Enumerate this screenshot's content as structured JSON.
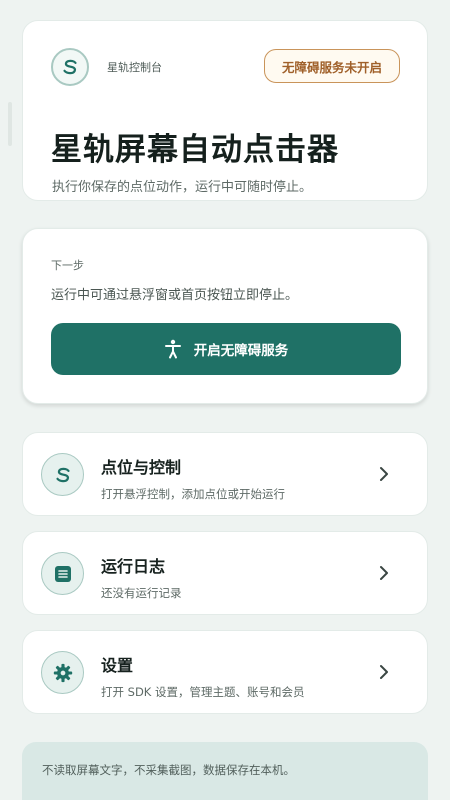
{
  "header": {
    "brand_name": "星轨控制台",
    "status_badge": "无障碍服务未开启",
    "title": "星轨屏幕自动点击器",
    "subtitle": "执行你保存的点位动作，运行中可随时停止。"
  },
  "next_step": {
    "label": "下一步",
    "description": "运行中可通过悬浮窗或首页按钮立即停止。",
    "button_label": "开启无障碍服务",
    "button_icon": "accessibility-icon"
  },
  "menu": [
    {
      "icon": "logo-s-icon",
      "title": "点位与控制",
      "subtitle": "打开悬浮控制，添加点位或开始运行"
    },
    {
      "icon": "list-log-icon",
      "title": "运行日志",
      "subtitle": "还没有运行记录"
    },
    {
      "icon": "gear-icon",
      "title": "设置",
      "subtitle": "打开 SDK 设置，管理主题、账号和会员"
    }
  ],
  "footer_notice": "不读取屏幕文字，不采集截图，数据保存在本机。",
  "colors": {
    "accent": "#1f7166",
    "background": "#eef3f1",
    "badge_border": "#c9945a",
    "badge_text": "#a0602a"
  }
}
